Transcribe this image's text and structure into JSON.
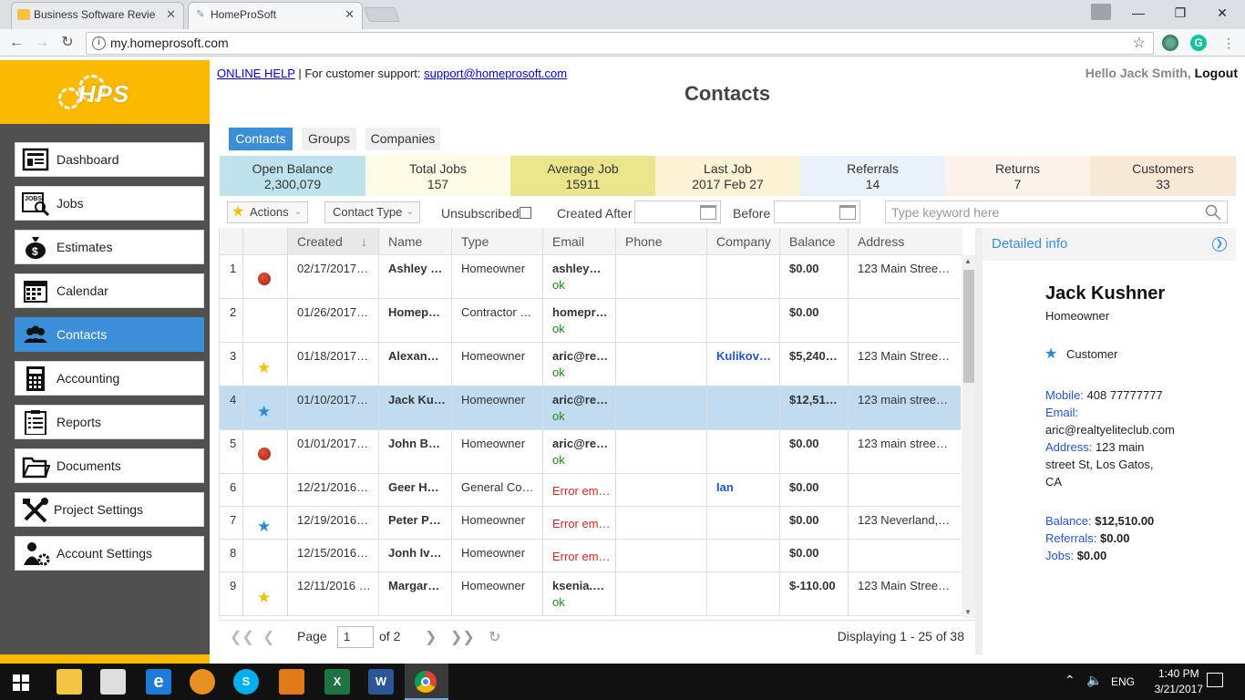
{
  "browser": {
    "tabs": [
      {
        "title": "Business Software Revie",
        "close": "✕"
      },
      {
        "title": "HomeProSoft",
        "close": "✕"
      }
    ],
    "url": "my.homeprosoft.com"
  },
  "sidebar": {
    "logo_text": "HPS",
    "items": [
      {
        "label": "Dashboard",
        "icon": "dashboard-icon"
      },
      {
        "label": "Jobs",
        "icon": "jobs-icon"
      },
      {
        "label": "Estimates",
        "icon": "money-bag-icon"
      },
      {
        "label": "Calendar",
        "icon": "calendar-icon"
      },
      {
        "label": "Contacts",
        "icon": "people-icon",
        "active": true
      },
      {
        "label": "Accounting",
        "icon": "calculator-icon"
      },
      {
        "label": "Reports",
        "icon": "clipboard-icon"
      },
      {
        "label": "Documents",
        "icon": "folder-icon"
      },
      {
        "label": "Project Settings",
        "icon": "tools-icon"
      },
      {
        "label": "Account Settings",
        "icon": "user-gear-icon"
      }
    ]
  },
  "header": {
    "online_help": "ONLINE HELP",
    "support_text": " | For customer support: ",
    "support_email": "support@homeprosoft.com",
    "hello": "Hello Jack Smith,",
    "logout": "Logout",
    "title": "Contacts"
  },
  "tabs": [
    "Contacts",
    "Groups",
    "Companies"
  ],
  "stats": [
    {
      "label": "Open Balance",
      "value": "2,300,079",
      "color": "#bfe3ec"
    },
    {
      "label": "Total Jobs",
      "value": "157",
      "color": "#fdfbe6"
    },
    {
      "label": "Average Job",
      "value": "15911",
      "color": "#ebe68c"
    },
    {
      "label": "Last Job",
      "value": "2017 Feb 27",
      "color": "#fcf3d4"
    },
    {
      "label": "Referrals",
      "value": "14",
      "color": "#e9f2fb"
    },
    {
      "label": "Returns",
      "value": "7",
      "color": "#fdf1ec"
    },
    {
      "label": "Customers",
      "value": "33",
      "color": "#f8e8d6"
    }
  ],
  "filters": {
    "actions": "Actions",
    "contact_type": "Contact Type",
    "unsubscribed": "Unsubscribed",
    "created_after": "Created After",
    "before": "Before",
    "search_placeholder": "Type keyword here"
  },
  "grid": {
    "columns": [
      "Created",
      "Name",
      "Type",
      "Email",
      "Phone",
      "Company",
      "Balance",
      "Address"
    ],
    "rows": [
      {
        "n": "1",
        "mark": "dot",
        "created": "02/17/2017…",
        "name": "Ashley …",
        "type": "Homeowner",
        "email": "ashley…",
        "status": "ok",
        "company": "",
        "balance": "$0.00",
        "address": "123 Main Stree…"
      },
      {
        "n": "2",
        "mark": "",
        "created": "01/26/2017…",
        "name": "Homep…",
        "type": "Contractor …",
        "email": "homepr…",
        "status": "ok",
        "company": "",
        "balance": "$0.00",
        "address": ""
      },
      {
        "n": "3",
        "mark": "star-gold",
        "created": "01/18/2017…",
        "name": "Alexan…",
        "type": "Homeowner",
        "email": "aric@re…",
        "status": "ok",
        "company": "Kulikov…",
        "balance": "$5,240…",
        "address": "123 Main Stree…"
      },
      {
        "n": "4",
        "mark": "star-blue",
        "created": "01/10/2017…",
        "name": "Jack Ku…",
        "type": "Homeowner",
        "email": "aric@re…",
        "status": "ok",
        "company": "",
        "balance": "$12,51…",
        "address": "123 main stree…",
        "selected": true
      },
      {
        "n": "5",
        "mark": "dot",
        "created": "01/01/2017…",
        "name": "John B…",
        "type": "Homeowner",
        "email": "aric@re…",
        "status": "ok",
        "company": "",
        "balance": "$0.00",
        "address": "123 main stree…"
      },
      {
        "n": "6",
        "mark": "",
        "created": "12/21/2016…",
        "name": "Geer H…",
        "type": "General Co…",
        "email": "Error em…",
        "status": "",
        "company": "Ian",
        "balance": "$0.00",
        "address": ""
      },
      {
        "n": "7",
        "mark": "star-blue",
        "created": "12/19/2016…",
        "name": "Peter P…",
        "type": "Homeowner",
        "email": "Error em…",
        "status": "",
        "company": "",
        "balance": "$0.00",
        "address": "123 Neverland,…"
      },
      {
        "n": "8",
        "mark": "",
        "created": "12/15/2016…",
        "name": "Jonh Iv…",
        "type": "Homeowner",
        "email": "Error em…",
        "status": "",
        "company": "",
        "balance": "$0.00",
        "address": ""
      },
      {
        "n": "9",
        "mark": "star-gold",
        "created": "12/11/2016 …",
        "name": "Margar…",
        "type": "Homeowner",
        "email": "ksenia.…",
        "status": "ok",
        "company": "",
        "balance": "$-110.00",
        "address": "123 Main Stree…"
      }
    ]
  },
  "pager": {
    "page_label": "Page",
    "page": "1",
    "of": "of 2",
    "displaying": "Displaying 1 - 25 of 38"
  },
  "detail": {
    "header": "Detailed info",
    "name": "Jack Kushner",
    "type": "Homeowner",
    "category": "Customer",
    "mobile_label": "Mobile:",
    "mobile": "408 77777777",
    "email_label": "Email:",
    "email": "aric@realtyeliteclub.com",
    "address_label": "Address:",
    "address_1": "123 main",
    "address_2": "street St, Los Gatos,",
    "address_3": "CA",
    "balance_label": "Balance:",
    "balance": "$12,510.00",
    "referrals_label": "Referrals:",
    "referrals": "$0.00",
    "jobs_label": "Jobs:",
    "jobs": "$0.00"
  },
  "taskbar": {
    "language": "ENG",
    "time": "1:40 PM",
    "date": "3/21/2017"
  }
}
